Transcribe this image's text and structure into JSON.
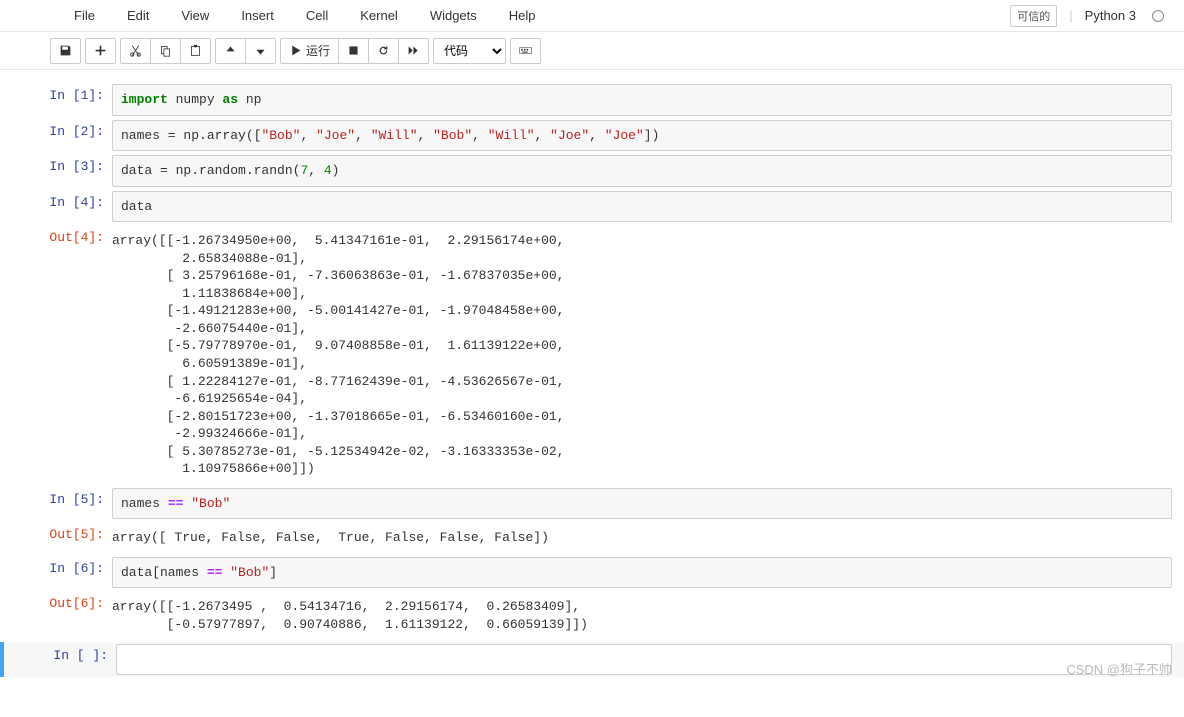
{
  "menubar": {
    "items": [
      "File",
      "Edit",
      "View",
      "Insert",
      "Cell",
      "Kernel",
      "Widgets",
      "Help"
    ],
    "trusted": "可信的",
    "kernel": "Python 3"
  },
  "toolbar": {
    "run_label": "运行",
    "cell_type": "代码"
  },
  "cells": [
    {
      "in_prompt": "In  [1]:",
      "code_html": "<span class='kw'>import</span> numpy <span class='kw'>as</span> np"
    },
    {
      "in_prompt": "In  [2]:",
      "code_html": "names = np.array([<span class='str'>\"Bob\"</span>, <span class='str'>\"Joe\"</span>, <span class='str'>\"Will\"</span>, <span class='str'>\"Bob\"</span>, <span class='str'>\"Will\"</span>, <span class='str'>\"Joe\"</span>, <span class='str'>\"Joe\"</span>])"
    },
    {
      "in_prompt": "In  [3]:",
      "code_html": "data = np.random.randn(<span class='num'>7</span>, <span class='num'>4</span>)"
    },
    {
      "in_prompt": "In  [4]:",
      "code_html": "data",
      "out_prompt": "Out[4]:",
      "output": "array([[-1.26734950e+00,  5.41347161e-01,  2.29156174e+00,\n         2.65834088e-01],\n       [ 3.25796168e-01, -7.36063863e-01, -1.67837035e+00,\n         1.11838684e+00],\n       [-1.49121283e+00, -5.00141427e-01, -1.97048458e+00,\n        -2.66075440e-01],\n       [-5.79778970e-01,  9.07408858e-01,  1.61139122e+00,\n         6.60591389e-01],\n       [ 1.22284127e-01, -8.77162439e-01, -4.53626567e-01,\n        -6.61925654e-04],\n       [-2.80151723e+00, -1.37018665e-01, -6.53460160e-01,\n        -2.99324666e-01],\n       [ 5.30785273e-01, -5.12534942e-02, -3.16333353e-02,\n         1.10975866e+00]])"
    },
    {
      "in_prompt": "In  [5]:",
      "code_html": "names <span class='op'>==</span> <span class='str'>\"Bob\"</span>",
      "out_prompt": "Out[5]:",
      "output": "array([ True, False, False,  True, False, False, False])"
    },
    {
      "in_prompt": "In  [6]:",
      "code_html": "data[names <span class='op'>==</span> <span class='str'>\"Bob\"</span>]",
      "out_prompt": "Out[6]:",
      "output": "array([[-1.2673495 ,  0.54134716,  2.29156174,  0.26583409],\n       [-0.57977897,  0.90740886,  1.61139122,  0.66059139]])"
    },
    {
      "in_prompt": "In  [ ]:",
      "code_html": " ",
      "selected": true
    }
  ],
  "watermark": "CSDN @狗子不帅"
}
